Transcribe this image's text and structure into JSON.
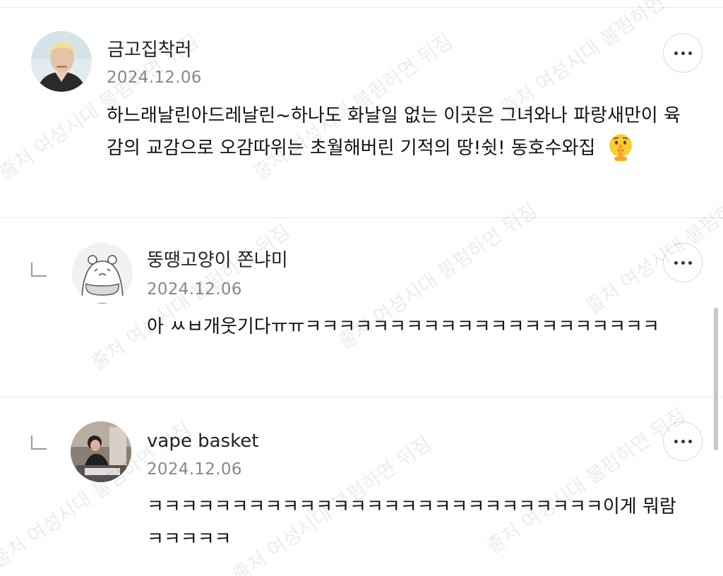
{
  "comments": [
    {
      "nickname": "금고집착러",
      "date": "2024.12.06",
      "content": "하느래날린아드레날린~하나도 화날일 없는 이곳은 그녀와나 파랑새만이 육감의 교감으로 오감따위는 초월해버린 기적의 땅!쉿! 동호수와집",
      "emoji": "shushing-face-emoji",
      "is_reply": false
    },
    {
      "nickname": "뚱땡고양이 쫀냐미",
      "date": "2024.12.06",
      "content": "아 ㅆㅂ개웃기다ㅠㅠㅋㅋㅋㅋㅋㅋㅋㅋㅋㅋㅋㅋㅋㅋㅋㅋㅋㅋㅋㅋㅋ",
      "is_reply": true
    },
    {
      "nickname": "vape basket",
      "date": "2024.12.06",
      "content": "ㅋㅋㅋㅋㅋㅋㅋㅋㅋㅋㅋㅋㅋㅋㅋㅋㅋㅋㅋㅋㅋㅋㅋㅋㅋㅋㅋ이게 뭐람ㅋㅋㅋㅋㅋ",
      "is_reply": true
    }
  ],
  "watermark": "출처 여성시대 불펌하면 뒤짐",
  "icons": {
    "more": "more-options-icon",
    "reply": "reply-indent-icon"
  },
  "colors": {
    "text": "#111111",
    "date": "#888888",
    "divider": "#e9e9e9"
  }
}
